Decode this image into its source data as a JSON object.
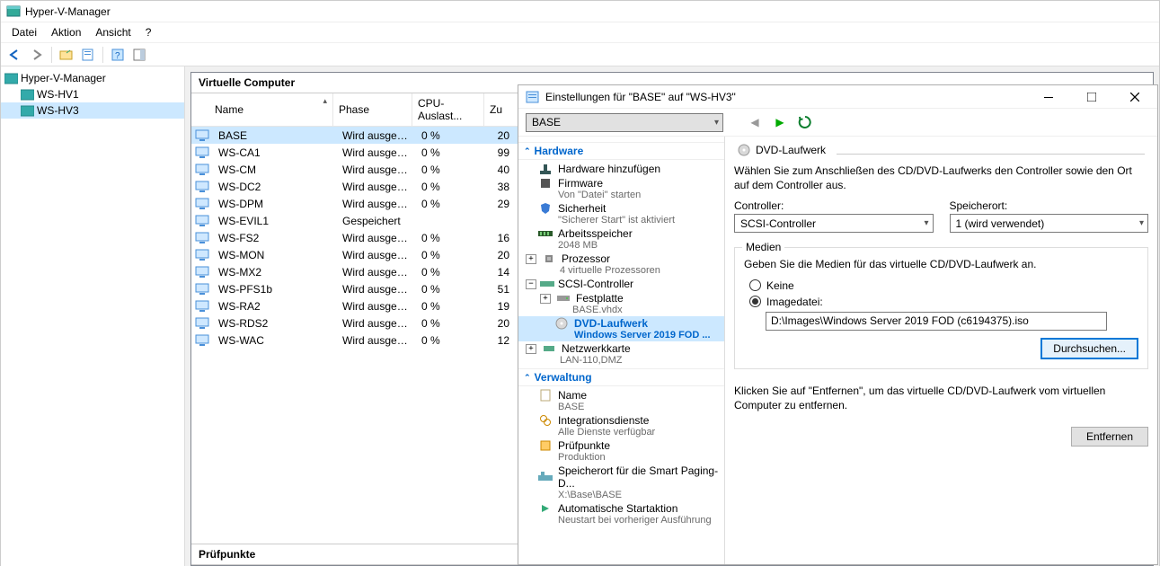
{
  "app": {
    "title": "Hyper-V-Manager"
  },
  "menu": {
    "file": "Datei",
    "action": "Aktion",
    "view": "Ansicht",
    "help": "?"
  },
  "tree": {
    "root": "Hyper-V-Manager",
    "nodes": [
      "WS-HV1",
      "WS-HV3"
    ],
    "selected": "WS-HV3"
  },
  "vmPanel": {
    "title": "Virtuelle Computer",
    "cols": {
      "name": "Name",
      "phase": "Phase",
      "cpu": "CPU-Auslast...",
      "zu": "Zu"
    },
    "rows": [
      {
        "name": "BASE",
        "phase": "Wird ausgeführt",
        "cpu": "0 %",
        "zu": "20",
        "sel": true
      },
      {
        "name": "WS-CA1",
        "phase": "Wird ausgeführt",
        "cpu": "0 %",
        "zu": "99"
      },
      {
        "name": "WS-CM",
        "phase": "Wird ausgeführt",
        "cpu": "0 %",
        "zu": "40"
      },
      {
        "name": "WS-DC2",
        "phase": "Wird ausgeführt",
        "cpu": "0 %",
        "zu": "38"
      },
      {
        "name": "WS-DPM",
        "phase": "Wird ausgeführt",
        "cpu": "0 %",
        "zu": "29"
      },
      {
        "name": "WS-EVIL1",
        "phase": "Gespeichert",
        "cpu": "",
        "zu": ""
      },
      {
        "name": "WS-FS2",
        "phase": "Wird ausgeführt",
        "cpu": "0 %",
        "zu": "16"
      },
      {
        "name": "WS-MON",
        "phase": "Wird ausgeführt",
        "cpu": "0 %",
        "zu": "20"
      },
      {
        "name": "WS-MX2",
        "phase": "Wird ausgeführt",
        "cpu": "0 %",
        "zu": "14"
      },
      {
        "name": "WS-PFS1b",
        "phase": "Wird ausgeführt",
        "cpu": "0 %",
        "zu": "51"
      },
      {
        "name": "WS-RA2",
        "phase": "Wird ausgeführt",
        "cpu": "0 %",
        "zu": "19"
      },
      {
        "name": "WS-RDS2",
        "phase": "Wird ausgeführt",
        "cpu": "0 %",
        "zu": "20"
      },
      {
        "name": "WS-WAC",
        "phase": "Wird ausgeführt",
        "cpu": "0 %",
        "zu": "12"
      }
    ]
  },
  "checkpoints": {
    "title": "Prüfpunkte"
  },
  "settings": {
    "title": "Einstellungen für \"BASE\" auf \"WS-HV3\"",
    "vm": "BASE",
    "sections": {
      "hardware": "Hardware",
      "management": "Verwaltung"
    },
    "hw": {
      "addHw": "Hardware hinzufügen",
      "firmware": "Firmware",
      "firmwareSub": "Von \"Datei\" starten",
      "security": "Sicherheit",
      "securitySub": "\"Sicherer Start\" ist aktiviert",
      "memory": "Arbeitsspeicher",
      "memorySub": "2048 MB",
      "cpu": "Prozessor",
      "cpuSub": "4 virtuelle Prozessoren",
      "scsi": "SCSI-Controller",
      "disk": "Festplatte",
      "diskSub": "BASE.vhdx",
      "dvd": "DVD-Laufwerk",
      "dvdSub": "Windows Server 2019 FOD ...",
      "net": "Netzwerkkarte",
      "netSub": "LAN-110,DMZ"
    },
    "mgmt": {
      "name": "Name",
      "nameSub": "BASE",
      "integ": "Integrationsdienste",
      "integSub": "Alle Dienste verfügbar",
      "check": "Prüfpunkte",
      "checkSub": "Produktion",
      "paging": "Speicherort für die Smart Paging-D...",
      "pagingSub": "X:\\Base\\BASE",
      "auto": "Automatische Startaktion",
      "autoSub": "Neustart bei vorheriger Ausführung"
    },
    "detail": {
      "header": "DVD-Laufwerk",
      "intro": "Wählen Sie zum Anschließen des CD/DVD-Laufwerks den Controller sowie den Ort auf dem Controller aus.",
      "controllerLbl": "Controller:",
      "controllerVal": "SCSI-Controller",
      "locationLbl": "Speicherort:",
      "locationVal": "1 (wird verwendet)",
      "mediaLegend": "Medien",
      "mediaIntro": "Geben Sie die Medien für das virtuelle CD/DVD-Laufwerk an.",
      "optNone": "Keine",
      "optImage": "Imagedatei:",
      "imagePath": "D:\\Images\\Windows Server 2019 FOD (c6194375).iso",
      "browseBtn": "Durchsuchen...",
      "removeIntro": "Klicken Sie auf \"Entfernen\", um das virtuelle CD/DVD-Laufwerk vom virtuellen Computer zu entfernen.",
      "removeBtn": "Entfernen"
    }
  }
}
